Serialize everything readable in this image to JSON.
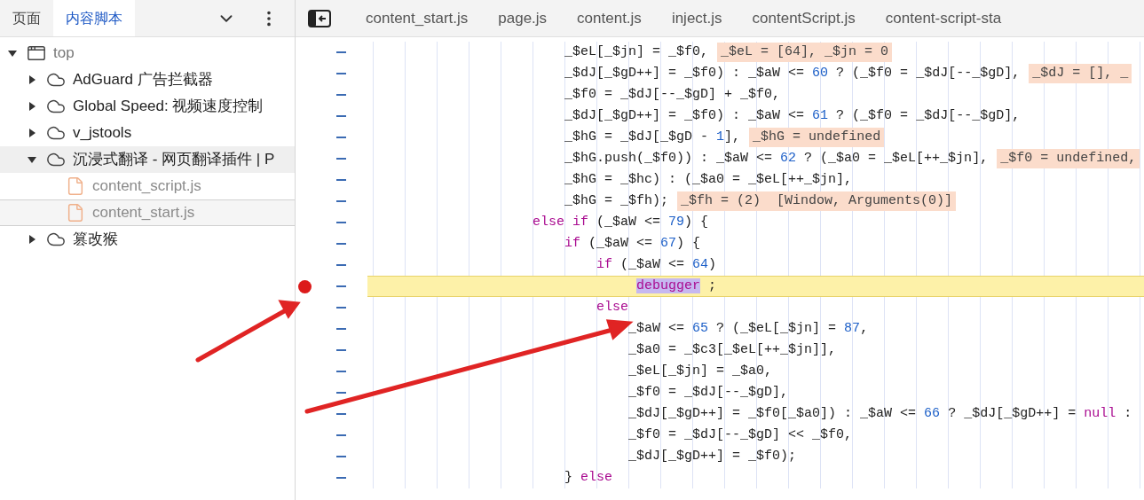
{
  "sidebar": {
    "tabs": [
      {
        "label": "页面",
        "selected": false
      },
      {
        "label": "内容脚本",
        "selected": true
      }
    ],
    "tree": [
      {
        "label": "top",
        "kind": "frame",
        "expanded": true,
        "selected": false,
        "hovered": false,
        "children": [
          {
            "label": "AdGuard 广告拦截器",
            "kind": "extension",
            "expanded": false,
            "selected": false,
            "hovered": false
          },
          {
            "label": "Global Speed: 视频速度控制",
            "kind": "extension",
            "expanded": false,
            "selected": false,
            "hovered": false
          },
          {
            "label": "v_jstools",
            "kind": "extension",
            "expanded": false,
            "selected": false,
            "hovered": false
          },
          {
            "label": "沉浸式翻译 - 网页翻译插件 | P",
            "kind": "extension",
            "expanded": true,
            "selected": false,
            "hovered": true,
            "children": [
              {
                "label": "content_script.js",
                "kind": "file",
                "selected": false,
                "hovered": false
              },
              {
                "label": "content_start.js",
                "kind": "file",
                "selected": true,
                "hovered": false
              }
            ]
          },
          {
            "label": "篡改猴",
            "kind": "extension",
            "expanded": false,
            "selected": false,
            "hovered": false
          }
        ]
      }
    ]
  },
  "editor": {
    "tabs": [
      {
        "label": "content_start.js",
        "selected": false
      },
      {
        "label": "page.js",
        "selected": false
      },
      {
        "label": "content.js",
        "selected": false
      },
      {
        "label": "inject.js",
        "selected": false
      },
      {
        "label": "contentScript.js",
        "selected": false
      },
      {
        "label": "content-script-sta",
        "selected": false
      }
    ],
    "lines": [
      {
        "paused": false,
        "breakpoint": false,
        "segments": [
          {
            "kind": "plain",
            "text": "                        _$eL[_$jn] = _$f0,"
          }
        ],
        "annotation": "_$eL = [64], _$jn = 0"
      },
      {
        "paused": false,
        "breakpoint": false,
        "segments": [
          {
            "kind": "plain",
            "text": "                        _$dJ[_$gD++] = _$f0) : _$aW <= "
          },
          {
            "kind": "number",
            "text": "60"
          },
          {
            "kind": "plain",
            "text": " ? (_$f0 = _$dJ[--_$gD],"
          }
        ],
        "annotation": "_$dJ = [], _"
      },
      {
        "paused": false,
        "breakpoint": false,
        "segments": [
          {
            "kind": "plain",
            "text": "                        _$f0 = _$dJ[--_$gD] + _$f0,"
          }
        ]
      },
      {
        "paused": false,
        "breakpoint": false,
        "segments": [
          {
            "kind": "plain",
            "text": "                        _$dJ[_$gD++] = _$f0) : _$aW <= "
          },
          {
            "kind": "number",
            "text": "61"
          },
          {
            "kind": "plain",
            "text": " ? (_$f0 = _$dJ[--_$gD],"
          }
        ]
      },
      {
        "paused": false,
        "breakpoint": false,
        "segments": [
          {
            "kind": "plain",
            "text": "                        _$hG = _$dJ[_$gD - "
          },
          {
            "kind": "number",
            "text": "1"
          },
          {
            "kind": "plain",
            "text": "],"
          }
        ],
        "annotation": "_$hG = undefined"
      },
      {
        "paused": false,
        "breakpoint": false,
        "segments": [
          {
            "kind": "plain",
            "text": "                        _$hG.push(_$f0)) : _$aW <= "
          },
          {
            "kind": "number",
            "text": "62"
          },
          {
            "kind": "plain",
            "text": " ? (_$a0 = _$eL[++_$jn],"
          }
        ],
        "annotation": "_$f0 = undefined,"
      },
      {
        "paused": false,
        "breakpoint": false,
        "segments": [
          {
            "kind": "plain",
            "text": "                        _$hG = _$hc) : (_$a0 = _$eL[++_$jn],"
          }
        ]
      },
      {
        "paused": false,
        "breakpoint": false,
        "segments": [
          {
            "kind": "plain",
            "text": "                        _$hG = _$fh);"
          }
        ],
        "annotation": "_$fh = (2)  [Window, Arguments(0)]"
      },
      {
        "paused": false,
        "breakpoint": false,
        "segments": [
          {
            "kind": "keyword",
            "text": "                    else if"
          },
          {
            "kind": "plain",
            "text": " (_$aW <= "
          },
          {
            "kind": "number",
            "text": "79"
          },
          {
            "kind": "plain",
            "text": ") {"
          }
        ]
      },
      {
        "paused": false,
        "breakpoint": false,
        "segments": [
          {
            "kind": "keyword",
            "text": "                        if"
          },
          {
            "kind": "plain",
            "text": " (_$aW <= "
          },
          {
            "kind": "number",
            "text": "67"
          },
          {
            "kind": "plain",
            "text": ") {"
          }
        ]
      },
      {
        "paused": false,
        "breakpoint": false,
        "segments": [
          {
            "kind": "keyword",
            "text": "                            if"
          },
          {
            "kind": "plain",
            "text": " (_$aW <= "
          },
          {
            "kind": "number",
            "text": "64"
          },
          {
            "kind": "plain",
            "text": ")"
          }
        ]
      },
      {
        "paused": true,
        "breakpoint": true,
        "segments": [
          {
            "kind": "match",
            "text": "                                 debugger"
          },
          {
            "kind": "plain",
            "text": " ;"
          }
        ]
      },
      {
        "paused": false,
        "breakpoint": false,
        "segments": [
          {
            "kind": "keyword",
            "text": "                            else"
          }
        ]
      },
      {
        "paused": false,
        "breakpoint": false,
        "segments": [
          {
            "kind": "plain",
            "text": "                                _$aW <= "
          },
          {
            "kind": "number",
            "text": "65"
          },
          {
            "kind": "plain",
            "text": " ? (_$eL[_$jn] = "
          },
          {
            "kind": "number",
            "text": "87"
          },
          {
            "kind": "plain",
            "text": ","
          }
        ]
      },
      {
        "paused": false,
        "breakpoint": false,
        "segments": [
          {
            "kind": "plain",
            "text": "                                _$a0 = _$c3[_$eL[++_$jn]],"
          }
        ]
      },
      {
        "paused": false,
        "breakpoint": false,
        "segments": [
          {
            "kind": "plain",
            "text": "                                _$eL[_$jn] = _$a0,"
          }
        ]
      },
      {
        "paused": false,
        "breakpoint": false,
        "segments": [
          {
            "kind": "plain",
            "text": "                                _$f0 = _$dJ[--_$gD],"
          }
        ]
      },
      {
        "paused": false,
        "breakpoint": false,
        "segments": [
          {
            "kind": "plain",
            "text": "                                _$dJ[_$gD++] = _$f0[_$a0]) : _$aW <= "
          },
          {
            "kind": "number",
            "text": "66"
          },
          {
            "kind": "plain",
            "text": " ? _$dJ[_$gD++] = "
          },
          {
            "kind": "keyword",
            "text": "null"
          },
          {
            "kind": "plain",
            "text": " :"
          }
        ]
      },
      {
        "paused": false,
        "breakpoint": false,
        "segments": [
          {
            "kind": "plain",
            "text": "                                _$f0 = _$dJ[--_$gD] << _$f0,"
          }
        ]
      },
      {
        "paused": false,
        "breakpoint": false,
        "segments": [
          {
            "kind": "plain",
            "text": "                                _$dJ[_$gD++] = _$f0);"
          }
        ]
      },
      {
        "paused": false,
        "breakpoint": false,
        "segments": [
          {
            "kind": "plain",
            "text": "                        } "
          },
          {
            "kind": "keyword",
            "text": "else"
          }
        ]
      }
    ]
  }
}
